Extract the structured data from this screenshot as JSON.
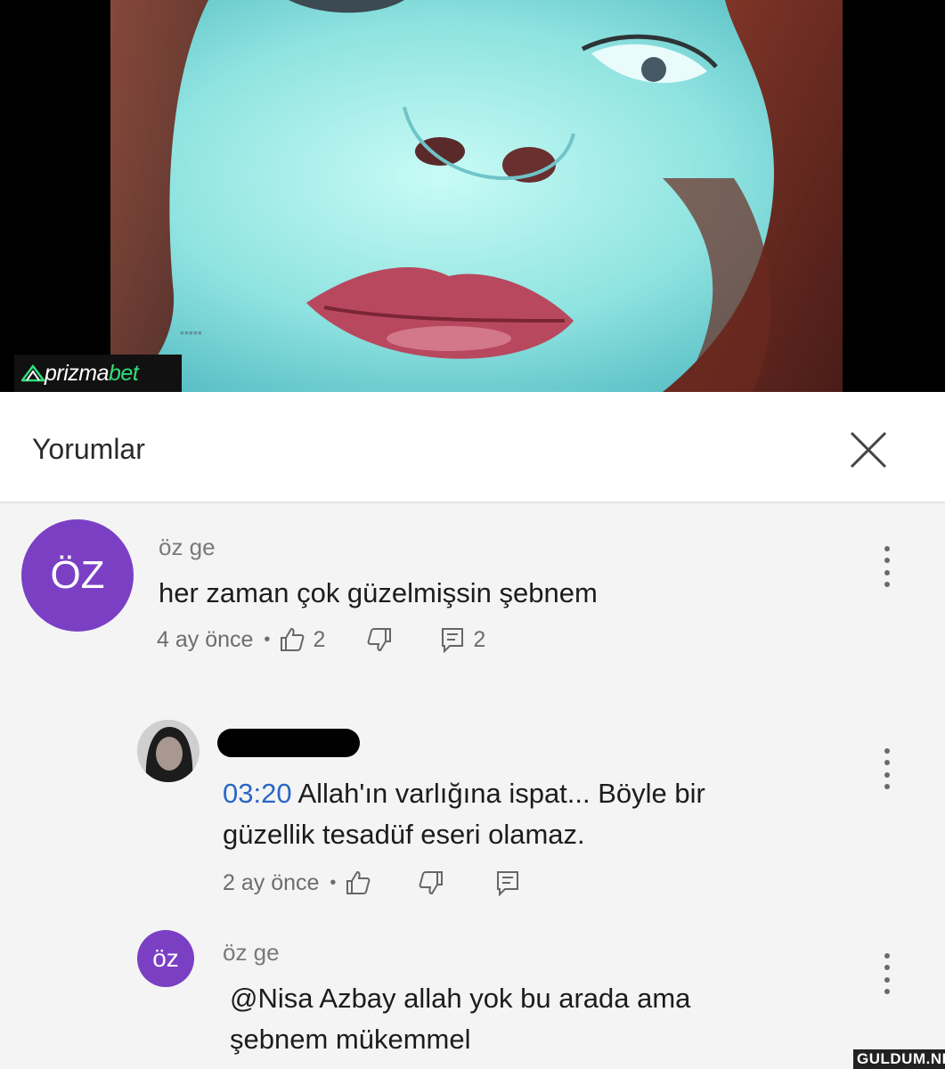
{
  "video": {
    "channel_logo": "tv-channel-logo",
    "brand": {
      "name": "prizma",
      "accent": "bet",
      "accent_color": "#2fe07a"
    }
  },
  "comments_panel": {
    "title": "Yorumlar",
    "close_icon": "close-icon"
  },
  "comments": [
    {
      "avatar_text": "ÖZ",
      "avatar_color": "#7b3fc4",
      "author": "öz ge",
      "text": "her zaman çok güzelmişsin şebnem",
      "time": "4 ay önce",
      "likes": "2",
      "replies": "2"
    },
    {
      "avatar_type": "photo",
      "author_redacted": true,
      "timestamp_link": "03:20",
      "text_line1": "Allah'ın varlığına ispat... Böyle bir",
      "text_line2": "güzellik tesadüf eseri olamaz.",
      "time": "2 ay önce"
    },
    {
      "avatar_text": "öz",
      "avatar_color": "#7b3fc4",
      "author": "öz ge",
      "text_line1": "@Nisa Azbay  allah yok bu arada ama",
      "text_line2": "şebnem mükemmel"
    }
  ],
  "meta_separator": "•",
  "watermark": "GULDUM.NET"
}
